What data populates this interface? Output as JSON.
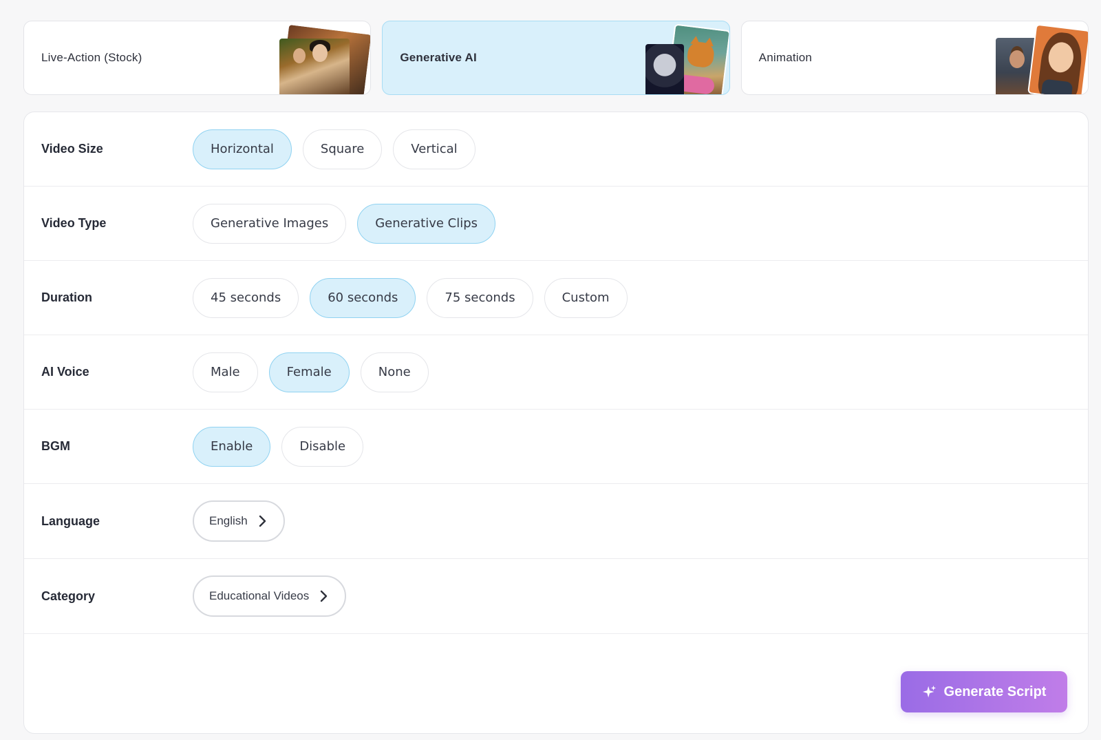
{
  "styles": [
    {
      "label": "Live-Action (Stock)",
      "selected": false,
      "icon": "stock-photo-thumbnail"
    },
    {
      "label": "Generative AI",
      "selected": true,
      "icon": "generative-ai-thumbnail"
    },
    {
      "label": "Animation",
      "selected": false,
      "icon": "animation-thumbnail"
    }
  ],
  "settings": {
    "video_size": {
      "label": "Video Size",
      "options": [
        "Horizontal",
        "Square",
        "Vertical"
      ],
      "selected": "Horizontal"
    },
    "video_type": {
      "label": "Video Type",
      "options": [
        "Generative Images",
        "Generative Clips"
      ],
      "selected": "Generative Clips"
    },
    "duration": {
      "label": "Duration",
      "options": [
        "45 seconds",
        "60 seconds",
        "75 seconds",
        "Custom"
      ],
      "selected": "60 seconds"
    },
    "ai_voice": {
      "label": "AI Voice",
      "options": [
        "Male",
        "Female",
        "None"
      ],
      "selected": "Female"
    },
    "bgm": {
      "label": "BGM",
      "options": [
        "Enable",
        "Disable"
      ],
      "selected": "Enable"
    },
    "language": {
      "label": "Language",
      "value": "English"
    },
    "category": {
      "label": "Category",
      "value": "Educational Videos"
    }
  },
  "generate_button": {
    "label": "Generate Script",
    "icon": "sparkle-icon"
  },
  "colors": {
    "selected_bg": "#d9f0fb",
    "selected_border": "#8fd2f1",
    "button_gradient_start": "#9a6ce6",
    "button_gradient_end": "#c07de8"
  }
}
